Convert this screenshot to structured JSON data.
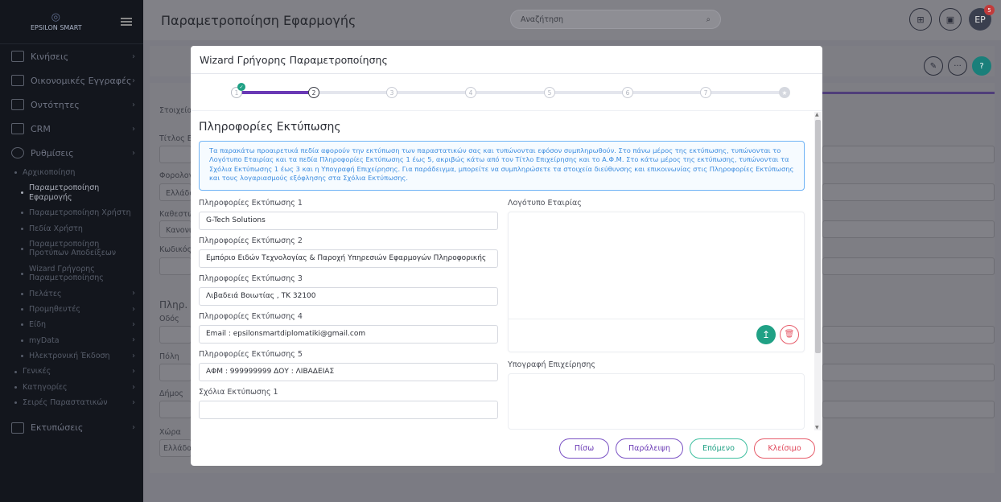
{
  "sidebar": {
    "logo_text": "EPSILON SMART",
    "items": [
      {
        "label": "Κινήσεις"
      },
      {
        "label": "Οικονομικές Εγγραφές"
      },
      {
        "label": "Οντότητες"
      },
      {
        "label": "CRM"
      },
      {
        "label": "Ρυθμίσεις"
      }
    ],
    "settings_sub": [
      {
        "label": "Αρχικοποίηση"
      },
      {
        "label": "Παραμετροποίηση Εφαρμογής"
      },
      {
        "label": "Παραμετροποίηση Χρήστη"
      },
      {
        "label": "Πεδία Χρήστη"
      },
      {
        "label": "Παραμετροποίηση Προτύπων Αποδείξεων"
      },
      {
        "label": "Wizard Γρήγορης Παραμετροποίησης"
      },
      {
        "label": "Πελάτες"
      },
      {
        "label": "Προμηθευτές"
      },
      {
        "label": "Είδη"
      },
      {
        "label": "myData"
      },
      {
        "label": "Ηλεκτρονική Έκδοση"
      },
      {
        "label": "Γενικές"
      },
      {
        "label": "Κατηγορίες"
      },
      {
        "label": "Σειρές Παραστατικών"
      }
    ],
    "last_item": "Εκτυπώσεις"
  },
  "topbar": {
    "title": "Παραμετροποίηση Εφαρμογής",
    "search_placeholder": "Αναζήτηση",
    "avatar_initials": "ΕΡ",
    "notifications_count": "5"
  },
  "background": {
    "tab_label": "Στοιχεία",
    "labels": [
      "Τίτλος Επ",
      "Φορολογ",
      "Ελλάδα",
      "Καθεστώ",
      "Κανονικ",
      "Κωδικός",
      "Πληρ. Δ",
      "Οδός",
      "Πόλη",
      "Δήμος",
      "Χώρα",
      "Ελλάδα"
    ]
  },
  "modal": {
    "title": "Wizard Γρήγορης Παραμετροποίησης",
    "steps": [
      "1",
      "2",
      "3",
      "4",
      "5",
      "6",
      "7"
    ],
    "current_step": 2,
    "section_title": "Πληροφορίες Εκτύπωσης",
    "info_text": "Τα παρακάτω προαιρετικά πεδία αφορούν την εκτύπωση των παραστατικών σας και τυπώνονται εφόσον συμπληρωθούν. Στο πάνω μέρος της εκτύπωσης, τυπώνονται το Λογότυπο Εταιρίας και τα πεδία Πληροφορίες Εκτύπωσης 1 έως 5, ακριβώς κάτω από τον Τίτλο Επιχείρησης και το Α.Φ.Μ. Στο κάτω μέρος της εκτύπωσης, τυπώνονται τα Σχόλια Εκτύπωσης 1 έως 3 και η Υπογραφή Επιχείρησης. Για παράδειγμα, μπορείτε να συμπληρώσετε τα στοιχεία διεύθυνσης και επικοινωνίας στις Πληροφορίες Εκτύπωσης και τους λογαριασμούς εξόφλησης στα Σχόλια Εκτύπωσης.",
    "fields": [
      {
        "label": "Πληροφορίες Εκτύπωσης 1",
        "value": "G-Tech Solutions"
      },
      {
        "label": "Πληροφορίες Εκτύπωσης 2",
        "value": "Εμπόριο Ειδών Τεχνολογίας & Παροχή Υπηρεσιών Εφαρμογών Πληροφορικής"
      },
      {
        "label": "Πληροφορίες Εκτύπωσης 3",
        "value": "Λιβαδειά Βοιωτίας , ΤΚ 32100"
      },
      {
        "label": "Πληροφορίες Εκτύπωσης 4",
        "value": "Email : epsilonsmartdiplomatiki@gmail.com"
      },
      {
        "label": "Πληροφορίες Εκτύπωσης 5",
        "value": "ΑΦΜ : 999999999 ΔΟΥ : ΛΙΒΑΔΕΙΑΣ"
      },
      {
        "label": "Σχόλια Εκτύπωσης 1",
        "value": ""
      }
    ],
    "logo_label": "Λογότυπο Εταιρίας",
    "signature_label": "Υπογραφή Επιχείρησης",
    "buttons": {
      "back": "Πίσω",
      "skip": "Παράλειψη",
      "next": "Επόμενο",
      "close": "Κλείσιμο"
    }
  }
}
